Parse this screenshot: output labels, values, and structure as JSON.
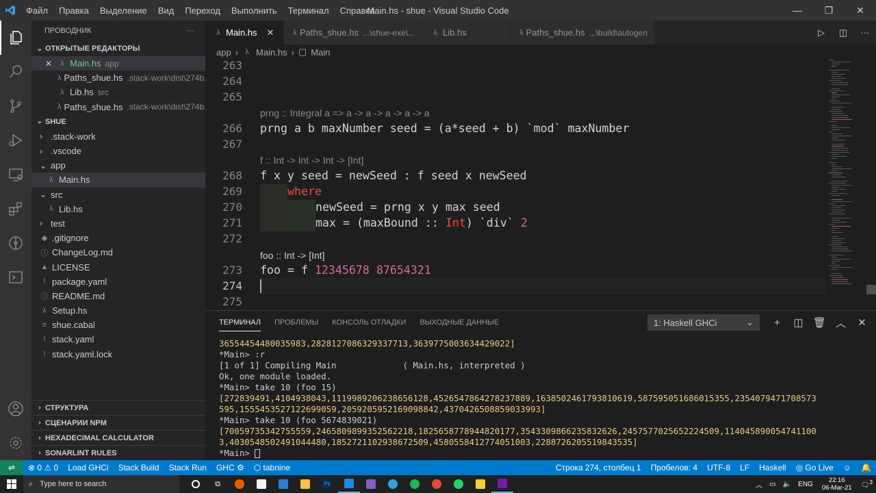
{
  "titlebar": {
    "menu": [
      "Файл",
      "Правка",
      "Выделение",
      "Вид",
      "Переход",
      "Выполнить",
      "Терминал",
      "Справка"
    ],
    "title": "Main.hs - shue - Visual Studio Code"
  },
  "sidebar": {
    "header": "ПРОВОДНИК",
    "open_editors_title": "ОТКРЫТЫЕ РЕДАКТОРЫ",
    "open_editors": [
      {
        "name": "Main.hs",
        "desc": "app"
      },
      {
        "name": "Paths_shue.hs",
        "desc": ".stack-work\\dist\\274b..."
      },
      {
        "name": "Lib.hs",
        "desc": "src"
      },
      {
        "name": "Paths_shue.hs",
        "desc": ".stack-work\\dist\\274b..."
      }
    ],
    "project_title": "SHUE",
    "tree": [
      {
        "name": ".stack-work",
        "kind": "folder",
        "indent": 1,
        "glyph": "›"
      },
      {
        "name": ".vscode",
        "kind": "folder",
        "indent": 1,
        "glyph": "›"
      },
      {
        "name": "app",
        "kind": "folder",
        "indent": 1,
        "glyph": "⌄"
      },
      {
        "name": "Main.hs",
        "kind": "hs",
        "indent": 2,
        "glyph": "λ"
      },
      {
        "name": "src",
        "kind": "folder",
        "indent": 1,
        "glyph": "⌄"
      },
      {
        "name": "Lib.hs",
        "kind": "hs",
        "indent": 2,
        "glyph": "λ"
      },
      {
        "name": "test",
        "kind": "folder",
        "indent": 1,
        "glyph": "›"
      },
      {
        "name": ".gitignore",
        "kind": "file",
        "indent": 1,
        "glyph": "◆"
      },
      {
        "name": "ChangeLog.md",
        "kind": "file",
        "indent": 1,
        "glyph": "ⓘ"
      },
      {
        "name": "LICENSE",
        "kind": "file",
        "indent": 1,
        "glyph": "▲"
      },
      {
        "name": "package.yaml",
        "kind": "file",
        "indent": 1,
        "glyph": "!"
      },
      {
        "name": "README.md",
        "kind": "file",
        "indent": 1,
        "glyph": "ⓘ"
      },
      {
        "name": "Setup.hs",
        "kind": "hs",
        "indent": 1,
        "glyph": "λ"
      },
      {
        "name": "shue.cabal",
        "kind": "file",
        "indent": 1,
        "glyph": "≡"
      },
      {
        "name": "stack.yaml",
        "kind": "file",
        "indent": 1,
        "glyph": "!"
      },
      {
        "name": "stack.yaml.lock",
        "kind": "file",
        "indent": 1,
        "glyph": "!"
      }
    ],
    "bottom_sections": [
      "СТРУКТУРА",
      "СЦЕНАРИИ NPM",
      "HEXADECIMAL CALCULATOR",
      "SONARLINT RULES"
    ]
  },
  "tabs": [
    {
      "name": "Main.hs",
      "desc": "",
      "active": true
    },
    {
      "name": "Paths_shue.hs",
      "desc": "...\\shue-exe\\...",
      "active": false
    },
    {
      "name": "Lib.hs",
      "desc": "",
      "active": false
    },
    {
      "name": "Paths_shue.hs",
      "desc": "...\\build\\autogen",
      "active": false
    }
  ],
  "breadcrumb": [
    "app",
    "Main.hs",
    "Main"
  ],
  "editor": {
    "lines": [
      {
        "n": "263"
      },
      {
        "n": "264"
      },
      {
        "n": "265"
      },
      {
        "lens": "prng :: Integral a => a -> a -> a -> a -> a"
      },
      {
        "n": "266",
        "code": "prng a b maxNumber seed = (a*seed + b) `mod` maxNumber"
      },
      {
        "n": "267"
      },
      {
        "lens": "f :: Int -> Int -> Int -> [Int]"
      },
      {
        "n": "268",
        "code": "f x y seed = newSeed : f seed x newSeed"
      },
      {
        "n": "269",
        "code": "where"
      },
      {
        "n": "270",
        "code": "newSeed = prng x y max seed"
      },
      {
        "n": "271",
        "code_a": "max = (maxBound :: ",
        "code_type": "Int",
        "code_b": ") `div` ",
        "code_num": "2"
      },
      {
        "n": "272"
      },
      {
        "lens": "foo :: Int -> [Int]"
      },
      {
        "n": "273",
        "code_a": "foo = f ",
        "code_num": "12345678 87654321"
      },
      {
        "n": "274"
      },
      {
        "n": "275"
      }
    ]
  },
  "panel": {
    "tabs": [
      "ТЕРМИНАЛ",
      "ПРОБЛЕМЫ",
      "КОНСОЛЬ ОТЛАДКИ",
      "ВЫХОДНЫЕ ДАННЫЕ"
    ],
    "terminal_select": "1: Haskell GHCi",
    "terminal_lines": [
      "36554454480035983,2828127086329337713,3639775003634429022]",
      "*Main> :r",
      "[1 of 1] Compiling Main             ( Main.hs, interpreted )",
      "Ok, one module loaded.",
      "*Main> take 10 (foo 15)",
      "[272839491,4104938043,1119989206238656128,4526547864278237889,1638502461793810619,587595051686015355,2354079471708573",
      "595,1555453527122699059,2059205952169098842,4370426508859033993]",
      "*Main> take 10 (foo 5674839021)",
      "[70059735342755559,2465809899352562218,1825658778944820177,3543309866235832626,2457577025652224509,114045890054741100",
      "3,4030548502491044480,1852721102938672509,4580558412774051003,2288726205519843535]"
    ],
    "prompt": "*Main> "
  },
  "status": {
    "errors": "0",
    "warnings": "0",
    "left_items": [
      "Load GHCi",
      "Stack Build",
      "Stack Run",
      "GHC",
      "tabnine"
    ],
    "right_items": [
      "Строка 274, столбец 1",
      "Пробелов: 4",
      "UTF-8",
      "LF",
      "Haskell",
      "Go Live"
    ]
  },
  "taskbar": {
    "search_placeholder": "Type here to search",
    "lang": "ENG",
    "time": "22:16",
    "date": "06-Mar-21",
    "notifications": "3"
  },
  "colors": {
    "accent": "#007acc",
    "keyword": "#f44747",
    "number": "#d16d9e",
    "haskell_icon": "#a074c4"
  }
}
